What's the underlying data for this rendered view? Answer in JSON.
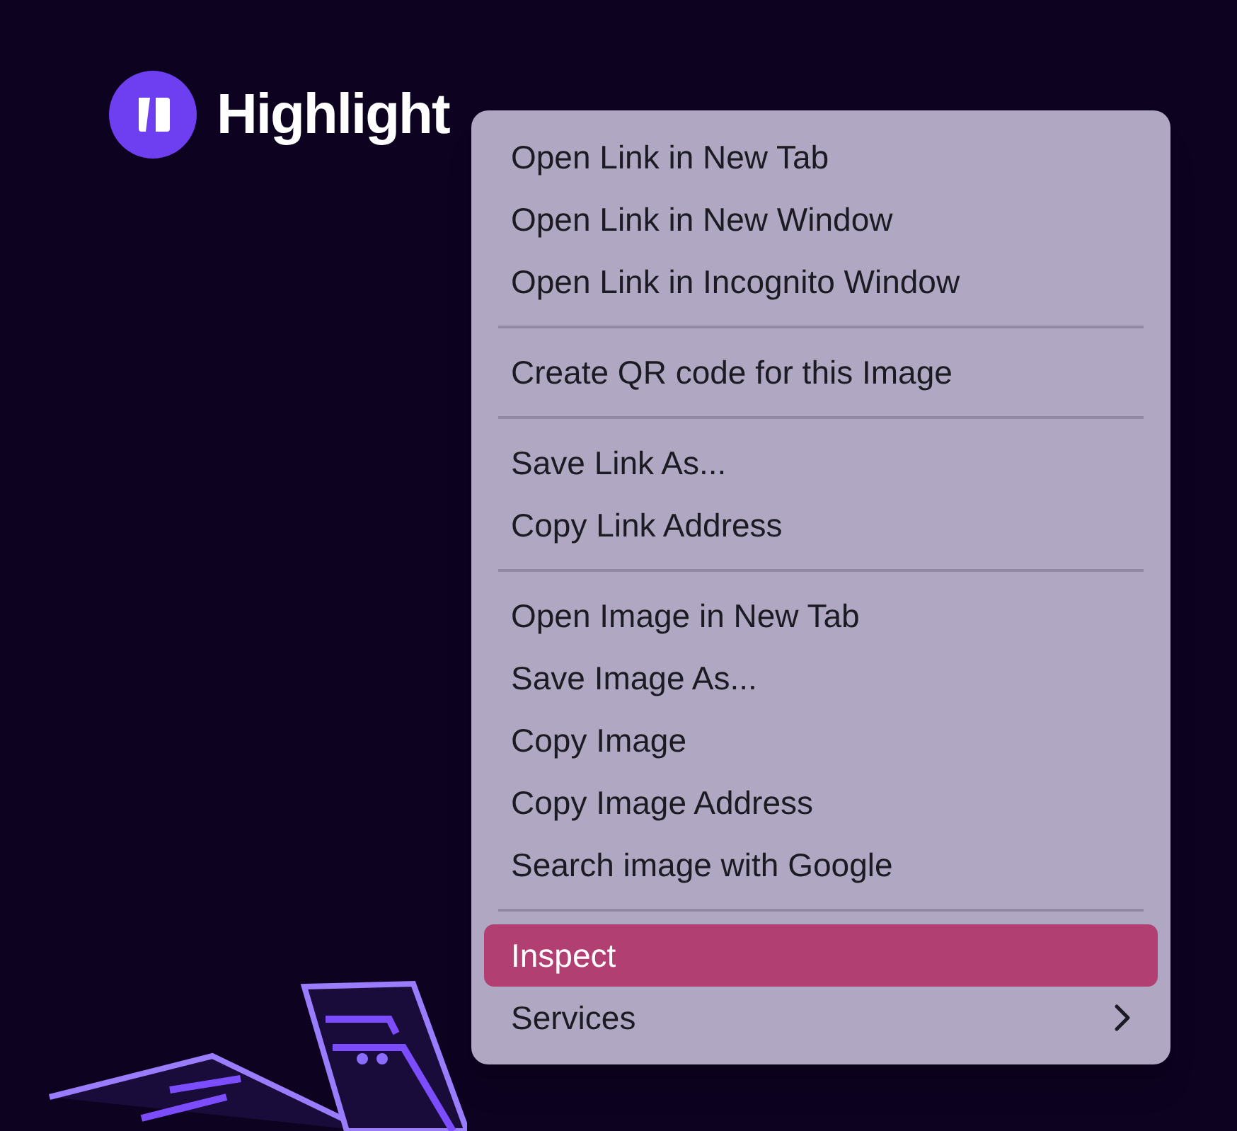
{
  "logo": {
    "name": "Highlight"
  },
  "context_menu": {
    "groups": [
      [
        {
          "label": "Open Link in New Tab",
          "kind": "action",
          "selected": false
        },
        {
          "label": "Open Link in New Window",
          "kind": "action",
          "selected": false
        },
        {
          "label": "Open Link in Incognito Window",
          "kind": "action",
          "selected": false
        }
      ],
      [
        {
          "label": "Create QR code for this Image",
          "kind": "action",
          "selected": false
        }
      ],
      [
        {
          "label": "Save Link As...",
          "kind": "action",
          "selected": false
        },
        {
          "label": "Copy Link Address",
          "kind": "action",
          "selected": false
        }
      ],
      [
        {
          "label": "Open Image in New Tab",
          "kind": "action",
          "selected": false
        },
        {
          "label": "Save Image As...",
          "kind": "action",
          "selected": false
        },
        {
          "label": "Copy Image",
          "kind": "action",
          "selected": false
        },
        {
          "label": "Copy Image Address",
          "kind": "action",
          "selected": false
        },
        {
          "label": "Search image with Google",
          "kind": "action",
          "selected": false
        }
      ],
      [
        {
          "label": "Inspect",
          "kind": "action",
          "selected": true
        },
        {
          "label": "Services",
          "kind": "submenu",
          "selected": false
        }
      ]
    ]
  }
}
